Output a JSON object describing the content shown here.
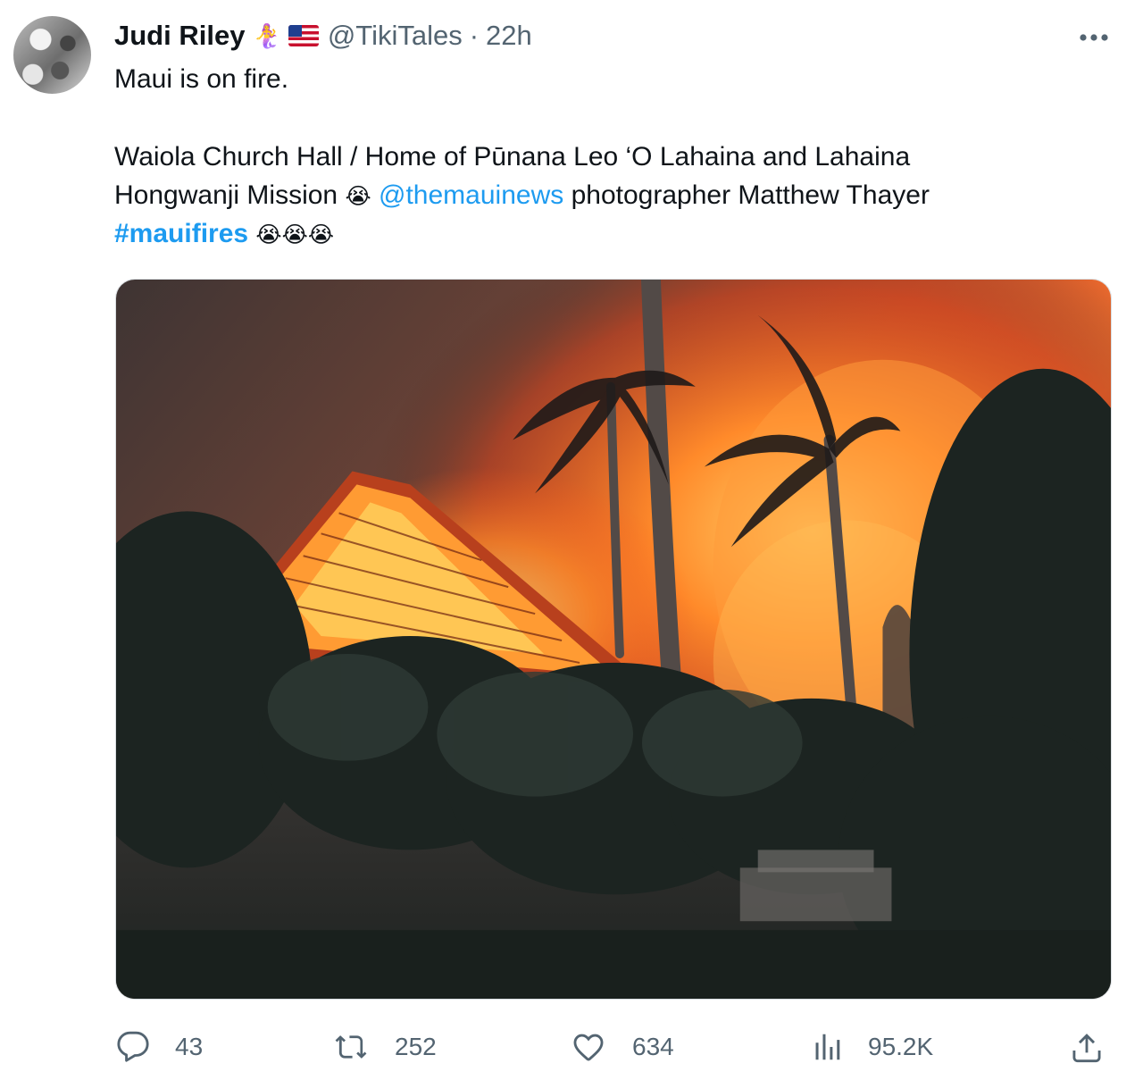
{
  "tweet": {
    "author": {
      "display_name": "Judi Riley",
      "badge_emoji": "🧜‍♀️",
      "handle": "@TikiTales",
      "separator": "·",
      "time": "22h"
    },
    "text": {
      "line1": "Maui is on fire.",
      "line2": "Waiola Church Hall / Home of Pūnana Leo ‘O Lahaina and Lahaina",
      "line3_prefix": "Hongwanji Mission",
      "line3_emoji": "😭",
      "mention": "@themauinews",
      "line3_suffix": "photographer Matthew Thayer",
      "hashtag": "#mauifires",
      "hashtag_emojis": "😭😭😭"
    },
    "media": {
      "description_icon": "photo"
    },
    "actions": {
      "reply_count": "43",
      "retweet_count": "252",
      "like_count": "634",
      "view_count": "95.2K"
    },
    "colors": {
      "link": "#1d9bf0",
      "secondary_text": "#536471",
      "primary_text": "#0f1419"
    }
  }
}
